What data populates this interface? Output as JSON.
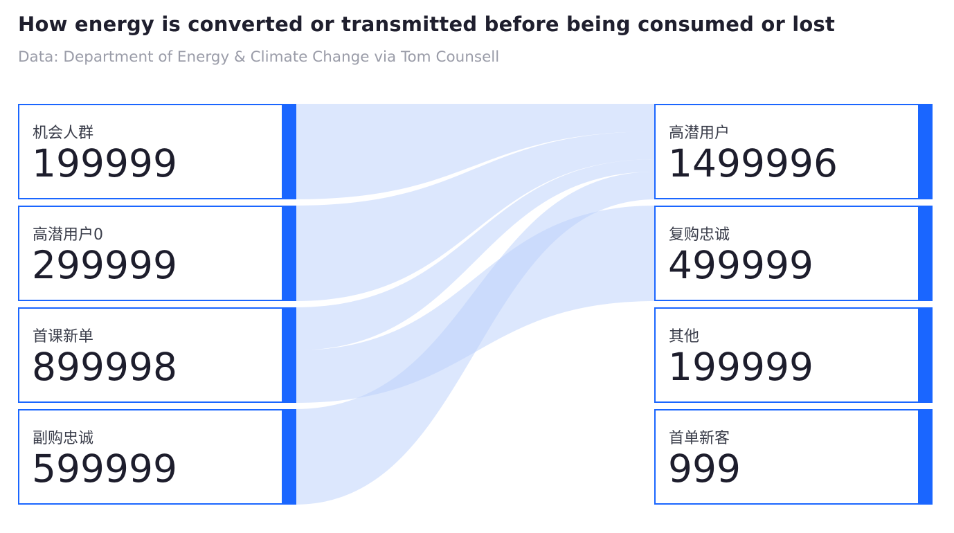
{
  "title": "How energy is converted or transmitted before being consumed or lost",
  "subtitle": "Data: Department of Energy & Climate Change via Tom Counsell",
  "chart_data": {
    "type": "sankey",
    "nodes": {
      "left": [
        {
          "label": "机会人群",
          "value": "199999"
        },
        {
          "label": "高潜用户0",
          "value": "299999"
        },
        {
          "label": "首课新单",
          "value": "899998"
        },
        {
          "label": "副购忠诚",
          "value": "599999"
        }
      ],
      "right": [
        {
          "label": "高潜用户",
          "value": "1499996"
        },
        {
          "label": "复购忠诚",
          "value": "499999"
        },
        {
          "label": "其他",
          "value": "199999"
        },
        {
          "label": "首单新客",
          "value": "999"
        }
      ]
    },
    "links": [
      {
        "source": 0,
        "target": 0,
        "share": 1.0
      },
      {
        "source": 1,
        "target": 0,
        "share": 1.0
      },
      {
        "source": 2,
        "target": 0,
        "share": 0.45
      },
      {
        "source": 2,
        "target": 1,
        "share": 0.55
      },
      {
        "source": 3,
        "target": 0,
        "share": 1.0
      }
    ],
    "colors": {
      "node": "#1a66ff",
      "link": "#b9d0fb"
    }
  }
}
